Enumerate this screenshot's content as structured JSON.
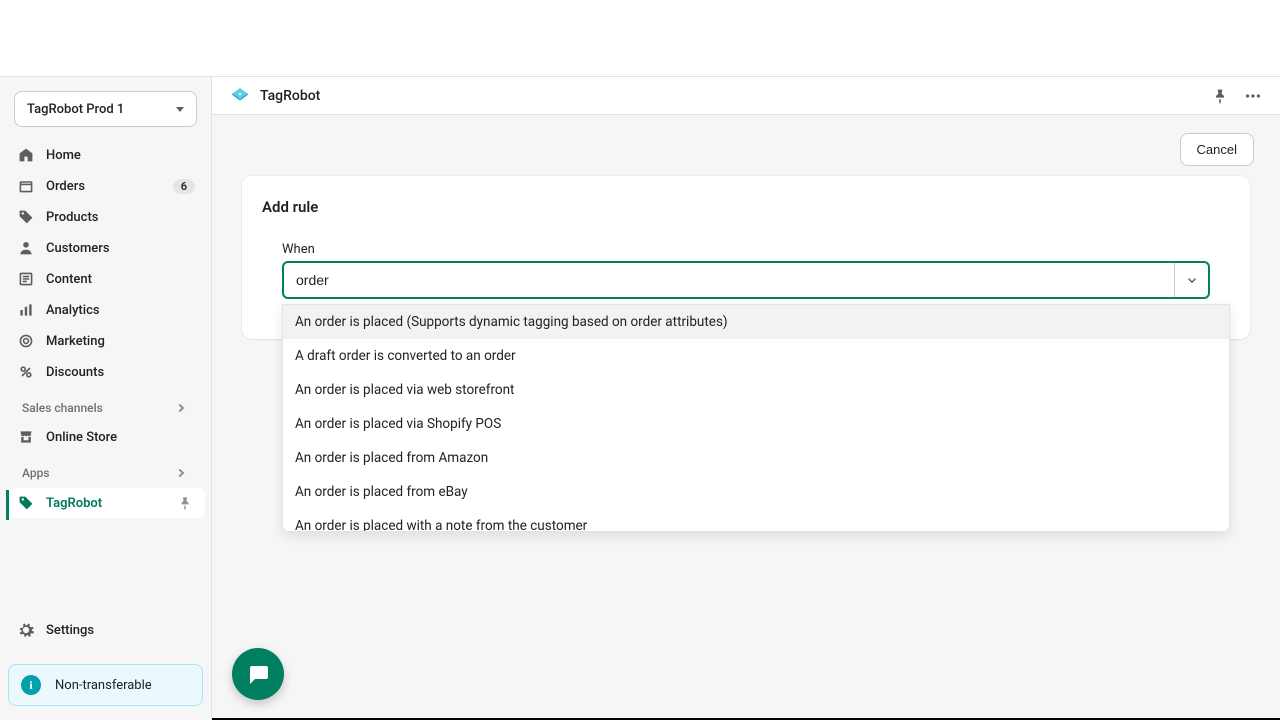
{
  "store_switcher": {
    "label": "TagRobot Prod 1"
  },
  "nav": {
    "items": [
      {
        "label": "Home",
        "icon": "home"
      },
      {
        "label": "Orders",
        "icon": "orders",
        "badge": "6"
      },
      {
        "label": "Products",
        "icon": "products"
      },
      {
        "label": "Customers",
        "icon": "customers"
      },
      {
        "label": "Content",
        "icon": "content"
      },
      {
        "label": "Analytics",
        "icon": "analytics"
      },
      {
        "label": "Marketing",
        "icon": "marketing"
      },
      {
        "label": "Discounts",
        "icon": "discounts"
      }
    ],
    "sales_channels_label": "Sales channels",
    "online_store_label": "Online Store",
    "apps_label": "Apps",
    "app_item_label": "TagRobot",
    "settings_label": "Settings"
  },
  "info_banner": {
    "text": "Non-transferable"
  },
  "header": {
    "app_name": "TagRobot"
  },
  "actions": {
    "cancel": "Cancel"
  },
  "card": {
    "title": "Add rule",
    "when_label": "When",
    "combo_value": "order",
    "options": [
      "An order is placed (Supports dynamic tagging based on order attributes)",
      "A draft order is converted to an order",
      "An order is placed via web storefront",
      "An order is placed via Shopify POS",
      "An order is placed from Amazon",
      "An order is placed from eBay",
      "An order is placed with a note from the customer"
    ]
  }
}
